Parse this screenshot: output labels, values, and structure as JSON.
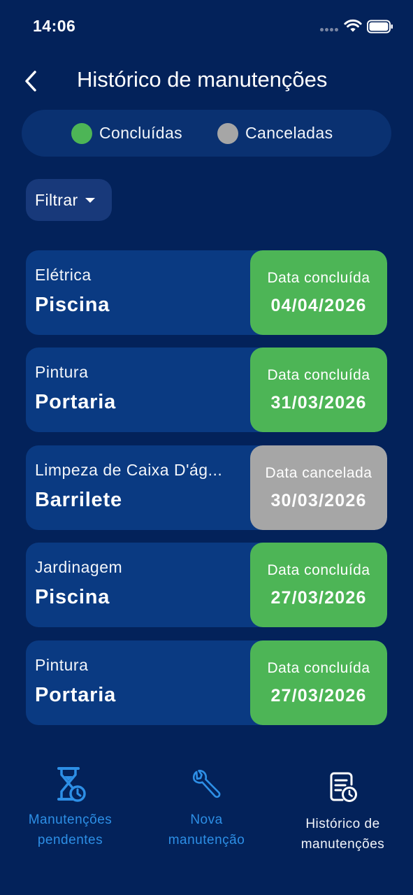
{
  "status_bar": {
    "time": "14:06"
  },
  "header": {
    "title": "Histórico de manutenções"
  },
  "legend": {
    "items": [
      {
        "label": "Concluídas",
        "color": "#4db556"
      },
      {
        "label": "Canceladas",
        "color": "#a6a6a6"
      }
    ]
  },
  "filter": {
    "label": "Filtrar"
  },
  "maintenances": [
    {
      "category": "Elétrica",
      "location": "Piscina",
      "status": "done",
      "date_label": "Data concluída",
      "date": "04/04/2026"
    },
    {
      "category": "Pintura",
      "location": "Portaria",
      "status": "done",
      "date_label": "Data concluída",
      "date": "31/03/2026"
    },
    {
      "category": "Limpeza de Caixa D'ág...",
      "location": "Barrilete",
      "status": "cancel",
      "date_label": "Data cancelada",
      "date": "30/03/2026"
    },
    {
      "category": "Jardinagem",
      "location": "Piscina",
      "status": "done",
      "date_label": "Data concluída",
      "date": "27/03/2026"
    },
    {
      "category": "Pintura",
      "location": "Portaria",
      "status": "done",
      "date_label": "Data concluída",
      "date": "27/03/2026"
    }
  ],
  "bottom_nav": {
    "items": [
      {
        "label": "Manutenções\npendentes",
        "icon": "hourglass-clock-icon"
      },
      {
        "label": "Nova\nmanutenção",
        "icon": "wrench-icon"
      },
      {
        "label": "Histórico de\nmanutenções",
        "icon": "document-clock-icon"
      }
    ]
  },
  "colors": {
    "background": "#03225a",
    "card": "#0a3a82",
    "done": "#4db556",
    "cancel": "#a6a6a6",
    "nav_accent": "#2d8fe6"
  }
}
